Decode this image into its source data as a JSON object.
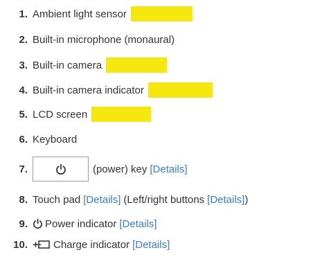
{
  "items": [
    {
      "num": "1.",
      "label": "Ambient light sensor",
      "highlight": true
    },
    {
      "num": "2.",
      "label": "Built-in microphone (monaural)"
    },
    {
      "num": "3.",
      "label": "Built-in camera",
      "highlight": true
    },
    {
      "num": "4.",
      "label": "Built-in camera indicator",
      "highlight": true
    },
    {
      "num": "5.",
      "label": "LCD screen",
      "highlight": true
    },
    {
      "num": "6.",
      "label": "Keyboard"
    },
    {
      "num": "7.",
      "label": "(power) key",
      "link": "[Details]",
      "key_icon": "power-icon"
    },
    {
      "num": "8.",
      "label": "Touch pad",
      "link": "[Details]",
      "label2": "(Left/right buttons",
      "link2": "[Details]",
      "tail": ")"
    },
    {
      "num": "9.",
      "label": "Power indicator",
      "link": "[Details]",
      "icon": "power-icon"
    },
    {
      "num": "10.",
      "label": "Charge indicator",
      "link": "[Details]",
      "icon": "charge-icon"
    }
  ],
  "colors": {
    "highlight": "#f6e70f",
    "link": "#3a7bd5",
    "text": "#333333"
  }
}
